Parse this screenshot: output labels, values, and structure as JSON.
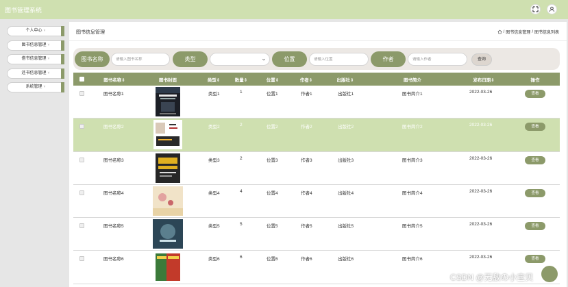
{
  "app": {
    "title": "图书管理系统"
  },
  "sidebar": {
    "items": [
      {
        "label": "个人中心"
      },
      {
        "label": "图书信息管理"
      },
      {
        "label": "借书信息管理"
      },
      {
        "label": "还书信息管理"
      },
      {
        "label": "系统管理"
      }
    ],
    "caret": "˅"
  },
  "header": {
    "title": "图书信息管理",
    "breadcrumb": [
      "图书信息管理",
      "图书信息列表"
    ],
    "separator": "/"
  },
  "search": {
    "name_label": "图书名称",
    "name_placeholder": "请输入图书名称",
    "type_label": "类型",
    "location_label": "位置",
    "location_placeholder": "请输入位置",
    "author_label": "作者",
    "author_placeholder": "请输入作者",
    "query_button": "查询"
  },
  "table": {
    "columns": [
      "图书名称⇕",
      "图书封面",
      "类型⇕",
      "数量⇕",
      "位置⇕",
      "作者⇕",
      "出版社⇕",
      "图书简介",
      "发布日期⇕",
      "操作"
    ],
    "view_label": "查看",
    "rows": [
      {
        "name": "图书名称1",
        "type": "类型1",
        "count": "1",
        "location": "位置1",
        "author": "作者1",
        "publisher": "出版社1",
        "intro": "图书简介1",
        "date": "2022-03-26"
      },
      {
        "name": "图书名称2",
        "type": "类型2",
        "count": "2",
        "location": "位置2",
        "author": "作者2",
        "publisher": "出版社2",
        "intro": "图书简介2",
        "date": "2022-03-26"
      },
      {
        "name": "图书名称3",
        "type": "类型3",
        "count": "2",
        "location": "位置3",
        "author": "作者3",
        "publisher": "出版社3",
        "intro": "图书简介3",
        "date": "2022-03-26"
      },
      {
        "name": "图书名称4",
        "type": "类型4",
        "count": "4",
        "location": "位置4",
        "author": "作者4",
        "publisher": "出版社4",
        "intro": "图书简介4",
        "date": "2022-03-26"
      },
      {
        "name": "图书名称5",
        "type": "类型5",
        "count": "5",
        "location": "位置5",
        "author": "作者5",
        "publisher": "出版社5",
        "intro": "图书简介5",
        "date": "2022-03-26"
      },
      {
        "name": "图书名称6",
        "type": "类型6",
        "count": "6",
        "location": "位置6",
        "author": "作者6",
        "publisher": "出版社6",
        "intro": "图书简介6",
        "date": "2022-03-26"
      }
    ]
  },
  "watermark": "CSDN @无敌の小宝贝",
  "colors": {
    "accent": "#8c9a6a",
    "topbar": "#cfe0b0",
    "highlight_row": "#cfe0b0"
  }
}
